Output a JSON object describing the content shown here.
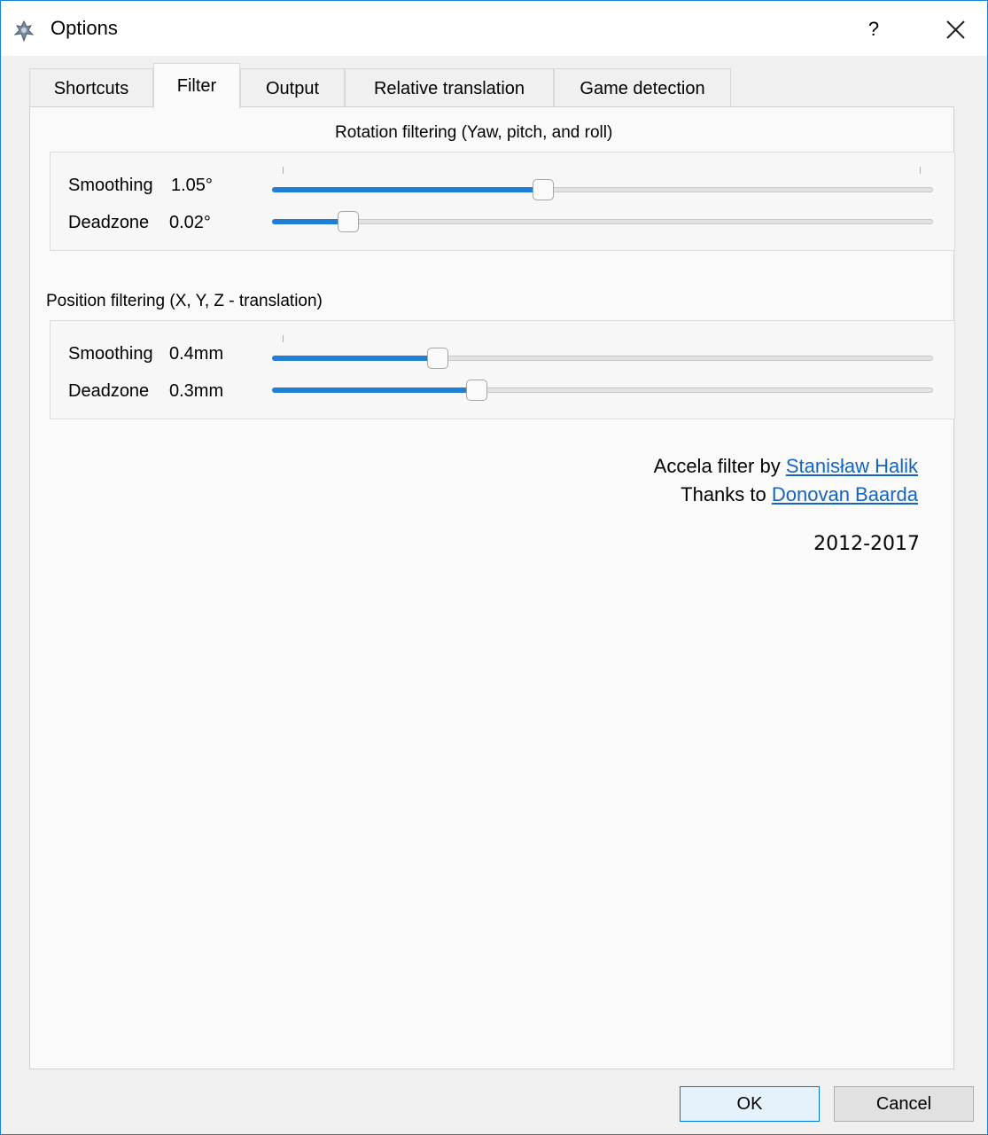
{
  "window": {
    "title": "Options",
    "help_label": "?"
  },
  "tabs": [
    {
      "label": "Shortcuts",
      "active": false
    },
    {
      "label": "Filter",
      "active": true
    },
    {
      "label": "Output",
      "active": false
    },
    {
      "label": "Relative translation",
      "active": false
    },
    {
      "label": "Game detection",
      "active": false
    }
  ],
  "rotation": {
    "heading": "Rotation filtering (Yaw, pitch, and roll)",
    "smoothing": {
      "label": "Smoothing",
      "value": "1.05°",
      "fraction": 0.41
    },
    "deadzone": {
      "label": "Deadzone",
      "value": "0.02°",
      "fraction": 0.115
    }
  },
  "position": {
    "heading": "Position filtering (X, Y, Z - translation)",
    "smoothing": {
      "label": "Smoothing",
      "value": "0.4mm",
      "fraction": 0.25
    },
    "deadzone": {
      "label": "Deadzone",
      "value": "0.3mm",
      "fraction": 0.31
    }
  },
  "credits": {
    "line1_prefix": "Accela filter by",
    "line1_link": "Stanisław Halik",
    "line2_prefix": "Thanks to",
    "line2_link": "Donovan Baarda",
    "years": "2012-2017"
  },
  "buttons": {
    "ok": "OK",
    "cancel": "Cancel"
  },
  "colors": {
    "accent": "#1e7fd4",
    "link": "#1565c0",
    "window_border": "#1883d7"
  }
}
